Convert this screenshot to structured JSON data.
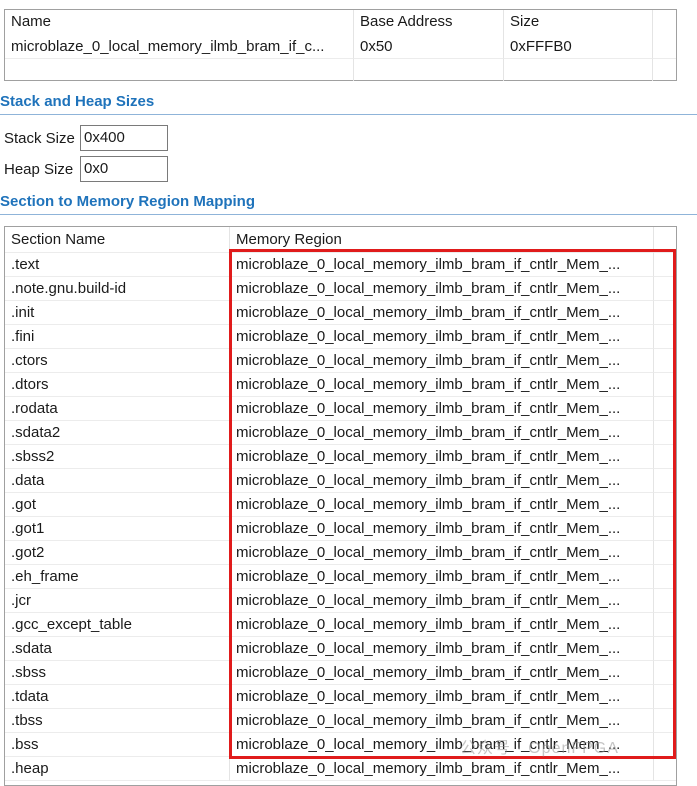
{
  "memory_table": {
    "headers": [
      "Name",
      "Base Address",
      "Size"
    ],
    "rows": [
      [
        "microblaze_0_local_memory_ilmb_bram_if_c...",
        "0x50",
        "0xFFFB0"
      ]
    ]
  },
  "stack_heap": {
    "title": "Stack and Heap Sizes",
    "stack_label": "Stack Size",
    "stack_value": "0x400",
    "heap_label": "Heap Size",
    "heap_value": "0x0"
  },
  "section_mapping": {
    "title": "Section to Memory Region Mapping",
    "headers": [
      "Section Name",
      "Memory Region"
    ],
    "rows": [
      [
        ".text",
        "microblaze_0_local_memory_ilmb_bram_if_cntlr_Mem_..."
      ],
      [
        ".note.gnu.build-id",
        "microblaze_0_local_memory_ilmb_bram_if_cntlr_Mem_..."
      ],
      [
        ".init",
        "microblaze_0_local_memory_ilmb_bram_if_cntlr_Mem_..."
      ],
      [
        ".fini",
        "microblaze_0_local_memory_ilmb_bram_if_cntlr_Mem_..."
      ],
      [
        ".ctors",
        "microblaze_0_local_memory_ilmb_bram_if_cntlr_Mem_..."
      ],
      [
        ".dtors",
        "microblaze_0_local_memory_ilmb_bram_if_cntlr_Mem_..."
      ],
      [
        ".rodata",
        "microblaze_0_local_memory_ilmb_bram_if_cntlr_Mem_..."
      ],
      [
        ".sdata2",
        "microblaze_0_local_memory_ilmb_bram_if_cntlr_Mem_..."
      ],
      [
        ".sbss2",
        "microblaze_0_local_memory_ilmb_bram_if_cntlr_Mem_..."
      ],
      [
        ".data",
        "microblaze_0_local_memory_ilmb_bram_if_cntlr_Mem_..."
      ],
      [
        ".got",
        "microblaze_0_local_memory_ilmb_bram_if_cntlr_Mem_..."
      ],
      [
        ".got1",
        "microblaze_0_local_memory_ilmb_bram_if_cntlr_Mem_..."
      ],
      [
        ".got2",
        "microblaze_0_local_memory_ilmb_bram_if_cntlr_Mem_..."
      ],
      [
        ".eh_frame",
        "microblaze_0_local_memory_ilmb_bram_if_cntlr_Mem_..."
      ],
      [
        ".jcr",
        "microblaze_0_local_memory_ilmb_bram_if_cntlr_Mem_..."
      ],
      [
        ".gcc_except_table",
        "microblaze_0_local_memory_ilmb_bram_if_cntlr_Mem_..."
      ],
      [
        ".sdata",
        "microblaze_0_local_memory_ilmb_bram_if_cntlr_Mem_..."
      ],
      [
        ".sbss",
        "microblaze_0_local_memory_ilmb_bram_if_cntlr_Mem_..."
      ],
      [
        ".tdata",
        "microblaze_0_local_memory_ilmb_bram_if_cntlr_Mem_..."
      ],
      [
        ".tbss",
        "microblaze_0_local_memory_ilmb_bram_if_cntlr_Mem_..."
      ],
      [
        ".bss",
        "microblaze_0_local_memory_ilmb_bram_if_cntlr_Mem_..."
      ],
      [
        ".heap",
        "microblaze_0_local_memory_ilmb_bram_if_cntlr_Mem_..."
      ]
    ]
  },
  "highlight_color": "#e01b1b",
  "title_color": "#1f73bb",
  "watermark_text": "公众号 · OpenFPGA"
}
